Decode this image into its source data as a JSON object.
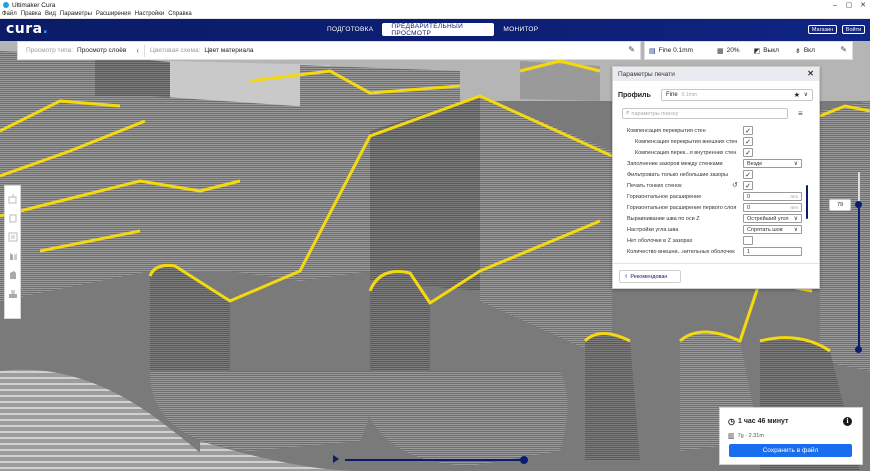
{
  "window": {
    "title": "Ultimaker Cura",
    "buttons": [
      "–",
      "▢",
      "✕"
    ]
  },
  "menu": [
    "Файл",
    "Правка",
    "Вид",
    "Параметры",
    "Расширения",
    "Настройки",
    "Справка"
  ],
  "header": {
    "logo": "cura",
    "tabs": [
      {
        "label": "ПОДГОТОВКА",
        "active": false
      },
      {
        "label": "ПРЕДВАРИТЕЛЬНЫЙ ПРОСМОТР",
        "active": true
      },
      {
        "label": "МОНИТОР",
        "active": false
      }
    ],
    "marketplace": "Магазин",
    "signin": "Войти"
  },
  "toolbar": {
    "view_type_label": "Просмотр типа:",
    "view_type_value": "Просмотр слоёв",
    "color_scheme_label": "Цветовая схема:",
    "color_scheme_value": "Цвет материала",
    "quality": "Fine 0.1mm",
    "infill": "20%",
    "support": "Выкл",
    "adhesion": "Вкл"
  },
  "panel": {
    "title": "Параметры печати",
    "profile_label": "Профиль",
    "profile_value": "Fine",
    "profile_sub": "0.1mm",
    "search_placeholder": "параметры поиску",
    "settings": [
      {
        "name": "Компенсация перекрытия стен",
        "type": "check",
        "value": "✓",
        "indent": 0
      },
      {
        "name": "Компенсация перекрытия внешних стен",
        "type": "check",
        "value": "✓",
        "indent": 1
      },
      {
        "name": "Компенсация перек...я внутренних стен",
        "type": "check",
        "value": "✓",
        "indent": 1
      },
      {
        "name": "Заполнение зазоров между стенками",
        "type": "select",
        "value": "Везде",
        "indent": 0
      },
      {
        "name": "Фильтровать только небольшие зазоры",
        "type": "check",
        "value": "✓",
        "indent": 0
      },
      {
        "name": "Печать тонких стенок",
        "type": "check",
        "value": "✓",
        "indent": 0,
        "reset": true
      },
      {
        "name": "Горизонтальное расширение",
        "type": "number",
        "value": "0",
        "unit": "mm",
        "indent": 0
      },
      {
        "name": "Горизонтальное расширение первого слоя",
        "type": "number",
        "value": "0",
        "unit": "mm",
        "indent": 0
      },
      {
        "name": "Выравнивание шва по оси Z",
        "type": "select",
        "value": "Острейший угол",
        "indent": 0
      },
      {
        "name": "Настройки угла шва",
        "type": "select",
        "value": "Спрятать шов",
        "indent": 0
      },
      {
        "name": "Нет оболочки в Z зазорах",
        "type": "check",
        "value": "",
        "indent": 0
      },
      {
        "name": "Количество внешни...нительных оболочек",
        "type": "number",
        "value": "1",
        "unit": "",
        "indent": 0
      }
    ],
    "recommended_button": "Рекомендован",
    "recommended_chevron": "‹"
  },
  "layer_slider": {
    "current": "79",
    "level": 0.79
  },
  "output": {
    "time": "1 час 46 минут",
    "material": "7g · 2.31m",
    "save_button": "Сохранить в файл"
  },
  "colors": {
    "header_bg": "#0a1c6e",
    "accent": "#196ef0",
    "model_outline": "#f5d90f",
    "model_body": "#8c8c8c"
  }
}
